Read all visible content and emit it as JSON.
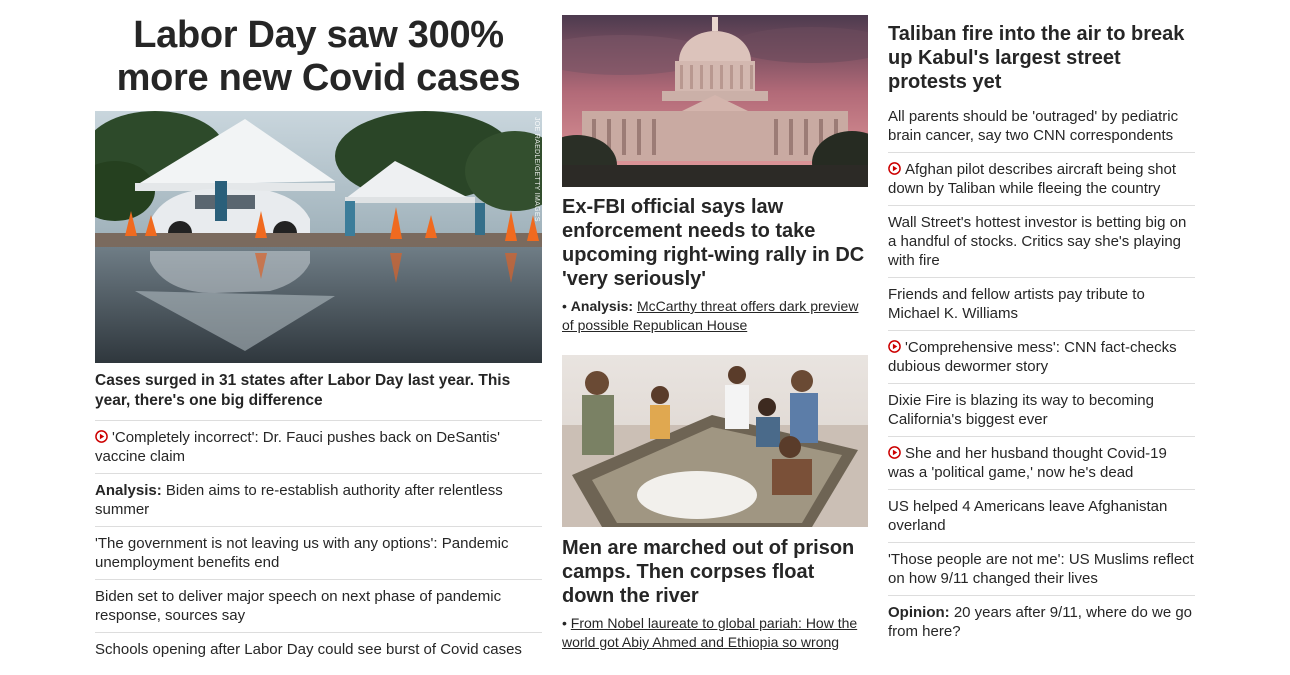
{
  "col1": {
    "headline": "Labor Day saw 300% more new Covid cases",
    "photo_credit": "JOE RAEDLE/GETTY IMAGES",
    "lead": "Cases surged in 31 states after Labor Day last year. This year, there's one big difference",
    "items": [
      {
        "icon": "play-icon",
        "text": "'Completely incorrect': Dr. Fauci pushes back on DeSantis' vaccine claim"
      },
      {
        "tag": "Analysis:",
        "text": "Biden aims to re-establish authority after relentless summer"
      },
      {
        "text": "'The government is not leaving us with any options': Pandemic unemployment benefits end"
      },
      {
        "text": "Biden set to deliver major speech on next phase of pandemic response, sources say"
      },
      {
        "text": "Schools opening after Labor Day could see burst of Covid cases"
      }
    ]
  },
  "col2": {
    "card1": {
      "headline": "Ex-FBI official says law enforcement needs to take upcoming right-wing rally in DC 'very seriously'",
      "sub_tag": "Analysis:",
      "sub_text": "McCarthy threat offers dark preview of possible Republican House"
    },
    "card2": {
      "headline": "Men are marched out of prison camps. Then corpses float down the river",
      "sub_text": "From Nobel laureate to global pariah: How the world got Abiy Ahmed and Ethiopia so wrong"
    }
  },
  "col3": {
    "headline": "Taliban fire into the air to break up Kabul's largest street protests yet",
    "items": [
      {
        "text": "All parents should be 'outraged' by pediatric brain cancer, say two CNN correspondents"
      },
      {
        "icon": "play-icon",
        "text": "Afghan pilot describes aircraft being shot down by Taliban while fleeing the country"
      },
      {
        "text": "Wall Street's hottest investor is betting big on a handful of stocks. Critics say she's playing with fire"
      },
      {
        "text": "Friends and fellow artists pay tribute to Michael K. Williams"
      },
      {
        "icon": "play-icon",
        "text": "'Comprehensive mess': CNN fact-checks dubious dewormer story"
      },
      {
        "text": "Dixie Fire is blazing its way to becoming California's biggest ever"
      },
      {
        "icon": "play-icon",
        "text": "She and her husband thought Covid-19 was a 'political game,' now he's dead"
      },
      {
        "text": "US helped 4 Americans leave Afghanistan overland"
      },
      {
        "text": "'Those people are not me': US Muslims reflect on how 9/11 changed their lives"
      },
      {
        "tag": "Opinion:",
        "text": "20 years after 9/11, where do we go from here?"
      }
    ]
  },
  "colors": {
    "video_red": "#cc0000",
    "text": "#262626",
    "divider": "#dddddd"
  }
}
